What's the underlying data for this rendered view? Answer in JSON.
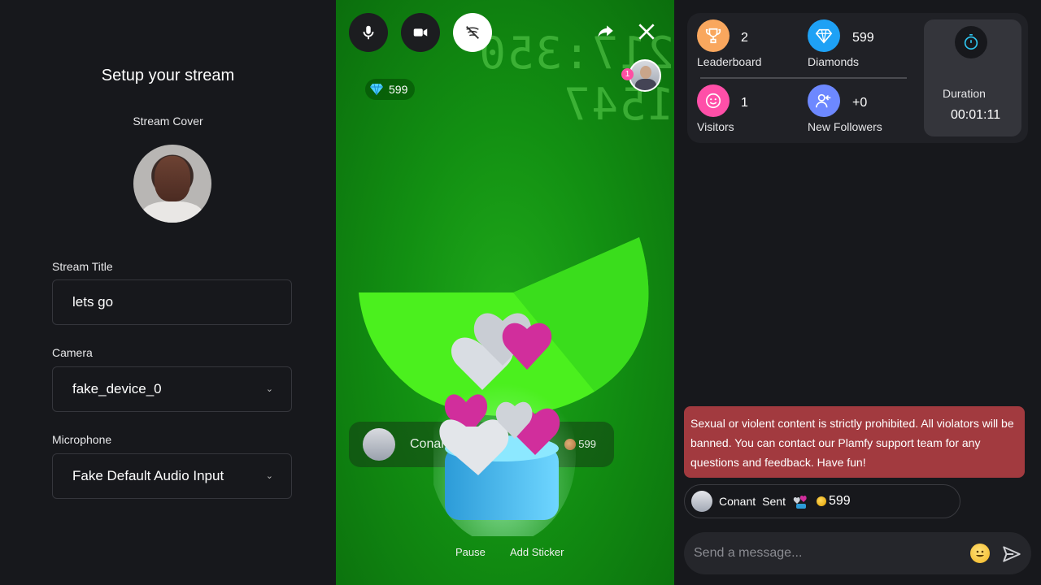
{
  "setup": {
    "title": "Setup your stream",
    "cover_label": "Stream Cover",
    "stream_title_label": "Stream Title",
    "stream_title_value": "lets go",
    "camera_label": "Camera",
    "camera_value": "fake_device_0",
    "microphone_label": "Microphone",
    "microphone_value": "Fake Default Audio Input"
  },
  "stage": {
    "background_text": "217:350 1547",
    "diamond_count": "599",
    "viewer_badge": "1",
    "gift_sender": "Conant",
    "gift_amount": "599",
    "pause_label": "Pause",
    "sticker_label": "Add Sticker"
  },
  "stats": {
    "leaderboard_value": "2",
    "leaderboard_label": "Leaderboard",
    "diamonds_value": "599",
    "diamonds_label": "Diamonds",
    "visitors_value": "1",
    "visitors_label": "Visitors",
    "followers_value": "+0",
    "followers_label": "New Followers",
    "duration_label": "Duration",
    "duration_value": "00:01:11"
  },
  "chat": {
    "notice": "Sexual or violent content is strictly prohibited. All violators will be banned. You can contact our Plamfy support team for any questions and feedback. Have fun!",
    "message_user": "Conant",
    "message_action": "Sent",
    "message_amount": "599",
    "input_placeholder": "Send a message..."
  },
  "colors": {
    "leaderboard": "#f9a75e",
    "diamonds": "#1ea1f5",
    "visitors": "#ff4fa8",
    "followers": "#6d88ff",
    "notice_bg": "#a23a3f",
    "stage_green": "#128f12"
  },
  "icons": [
    "microphone-icon",
    "video-camera-icon",
    "effects-off-icon",
    "share-icon",
    "close-icon",
    "trophy-icon",
    "diamond-icon",
    "smiley-icon",
    "follower-icon",
    "stopwatch-icon",
    "emoji-icon",
    "send-icon",
    "chevron-down-icon"
  ]
}
